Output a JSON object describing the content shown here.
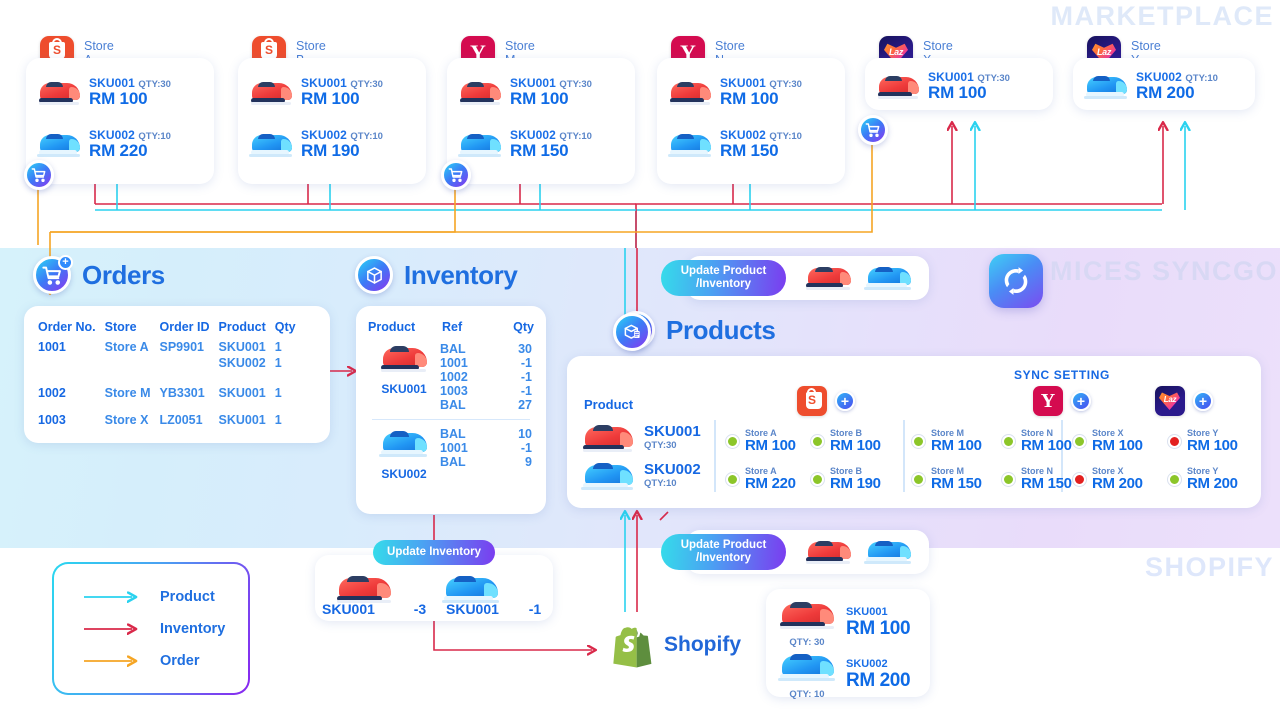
{
  "watermarks": {
    "top_right": "MARKETPLACE",
    "middle_right": "MICES SYNCGO",
    "bottom_right": "SHOPIFY"
  },
  "marketplace": {
    "stores": [
      {
        "name": "Store A",
        "platform": "shopee",
        "platform_icon": "shopee-icon",
        "has_cart_badge": true,
        "items": [
          {
            "sku": "SKU001",
            "qty": "QTY:30",
            "price": "RM 100",
            "shoe": "red"
          },
          {
            "sku": "SKU002",
            "qty": "QTY:10",
            "price": "RM 220",
            "shoe": "blue"
          }
        ]
      },
      {
        "name": "Store B",
        "platform": "shopee",
        "platform_icon": "shopee-icon",
        "has_cart_badge": false,
        "items": [
          {
            "sku": "SKU001",
            "qty": "QTY:30",
            "price": "RM 100",
            "shoe": "red"
          },
          {
            "sku": "SKU002",
            "qty": "QTY:10",
            "price": "RM 190",
            "shoe": "blue"
          }
        ]
      },
      {
        "name": "Store M",
        "platform": "yahoo",
        "platform_icon": "yahoo-icon",
        "has_cart_badge": true,
        "items": [
          {
            "sku": "SKU001",
            "qty": "QTY:30",
            "price": "RM 100",
            "shoe": "red"
          },
          {
            "sku": "SKU002",
            "qty": "QTY:10",
            "price": "RM 150",
            "shoe": "blue"
          }
        ]
      },
      {
        "name": "Store N",
        "platform": "yahoo",
        "platform_icon": "yahoo-icon",
        "has_cart_badge": false,
        "items": [
          {
            "sku": "SKU001",
            "qty": "QTY:30",
            "price": "RM 100",
            "shoe": "red"
          },
          {
            "sku": "SKU002",
            "qty": "QTY:10",
            "price": "RM 150",
            "shoe": "blue"
          }
        ]
      },
      {
        "name": "Store X",
        "platform": "lazada",
        "platform_icon": "lazada-icon",
        "has_cart_badge": true,
        "items": [
          {
            "sku": "SKU001",
            "qty": "QTY:30",
            "price": "RM 100",
            "shoe": "red"
          }
        ]
      },
      {
        "name": "Store Y",
        "platform": "lazada",
        "platform_icon": "lazada-icon",
        "has_cart_badge": false,
        "items": [
          {
            "sku": "SKU002",
            "qty": "QTY:10",
            "price": "RM 200",
            "shoe": "blue"
          }
        ]
      }
    ]
  },
  "orders": {
    "title": "Orders",
    "icon": "cart-plus-icon",
    "columns": [
      "Order No.",
      "Store",
      "Order ID",
      "Product",
      "Qty"
    ],
    "rows": [
      {
        "order_no": "1001",
        "store": "Store A",
        "order_id": "SP9901",
        "product": "SKU001",
        "qty": "1"
      },
      {
        "order_no": "",
        "store": "",
        "order_id": "",
        "product": "SKU002",
        "qty": "1"
      },
      {
        "order_no": "1002",
        "store": "Store M",
        "order_id": "YB3301",
        "product": "SKU001",
        "qty": "1"
      },
      {
        "order_no": "1003",
        "store": "Store X",
        "order_id": "LZ0051",
        "product": "SKU001",
        "qty": "1"
      }
    ]
  },
  "inventory": {
    "title": "Inventory",
    "icon": "box-sync-icon",
    "columns": [
      "Product",
      "Ref",
      "Qty"
    ],
    "groups": [
      {
        "sku": "SKU001",
        "shoe": "red",
        "lines": [
          {
            "ref": "BAL",
            "qty": "30"
          },
          {
            "ref": "1001",
            "qty": "-1"
          },
          {
            "ref": "1002",
            "qty": "-1"
          },
          {
            "ref": "1003",
            "qty": "-1"
          },
          {
            "ref": "BAL",
            "qty": "27"
          }
        ]
      },
      {
        "sku": "SKU002",
        "shoe": "blue",
        "lines": [
          {
            "ref": "BAL",
            "qty": "10"
          },
          {
            "ref": "1001",
            "qty": "-1"
          },
          {
            "ref": "BAL",
            "qty": "9"
          }
        ]
      }
    ]
  },
  "products": {
    "title": "Products",
    "icon": "product-box-icon",
    "sync_setting_label": "SYNC SETTING",
    "product_column_label": "Product",
    "platform_groups": [
      {
        "platform": "shopee",
        "platform_icon": "shopee-icon",
        "add_label": "+"
      },
      {
        "platform": "yahoo",
        "platform_icon": "yahoo-icon",
        "add_label": "+"
      },
      {
        "platform": "lazada",
        "platform_icon": "lazada-icon",
        "add_label": "+"
      }
    ],
    "rows": [
      {
        "sku": "SKU001",
        "qty": "QTY:30",
        "shoe": "red",
        "cells": [
          {
            "store": "Store A",
            "price": "RM 100",
            "status": "green"
          },
          {
            "store": "Store B",
            "price": "RM 100",
            "status": "green"
          },
          {
            "store": "Store M",
            "price": "RM 100",
            "status": "green"
          },
          {
            "store": "Store N",
            "price": "RM 100",
            "status": "green"
          },
          {
            "store": "Store X",
            "price": "RM 100",
            "status": "green"
          },
          {
            "store": "Store Y",
            "price": "RM 100",
            "status": "red"
          }
        ]
      },
      {
        "sku": "SKU002",
        "qty": "QTY:10",
        "shoe": "blue",
        "cells": [
          {
            "store": "Store A",
            "price": "RM 220",
            "status": "green"
          },
          {
            "store": "Store B",
            "price": "RM 190",
            "status": "green"
          },
          {
            "store": "Store M",
            "price": "RM 150",
            "status": "green"
          },
          {
            "store": "Store N",
            "price": "RM 150",
            "status": "green"
          },
          {
            "store": "Store X",
            "price": "RM 200",
            "status": "red"
          },
          {
            "store": "Store Y",
            "price": "RM 200",
            "status": "green"
          }
        ]
      }
    ]
  },
  "update_badges": {
    "top": {
      "label": "Update Product\n/Inventory",
      "line1": "Update Product",
      "line2": "/Inventory"
    },
    "bottom": {
      "label": "Update Product\n/Inventory",
      "line1": "Update Product",
      "line2": "/Inventory"
    }
  },
  "update_inventory": {
    "pill_label": "Update Inventory",
    "items": [
      {
        "sku": "SKU001",
        "delta": "-3",
        "shoe": "red"
      },
      {
        "sku": "SKU001",
        "delta": "-1",
        "shoe": "blue"
      }
    ]
  },
  "shopify": {
    "name": "Shopify",
    "icon": "shopify-bag-icon",
    "items": [
      {
        "sku": "SKU001",
        "qty": "QTY: 30",
        "price": "RM 100",
        "shoe": "red"
      },
      {
        "sku": "SKU002",
        "qty": "QTY: 10",
        "price": "RM 200",
        "shoe": "blue"
      }
    ]
  },
  "syncgo": {
    "logo_label": "S",
    "logo_icon": "syncgo-logo-icon"
  },
  "legend": {
    "items": [
      {
        "label": "Product",
        "color": "#2ad2ef"
      },
      {
        "label": "Inventory",
        "color": "#d9294a"
      },
      {
        "label": "Order",
        "color": "#f5a524"
      }
    ]
  },
  "colors": {
    "product_flow": "#2ad2ef",
    "inventory_flow": "#d9294a",
    "order_flow": "#f5a524",
    "primary_blue": "#1f6fe0",
    "price_blue": "#0f6be6",
    "status_green": "#8cc62a",
    "status_red": "#e32020",
    "shopee_orange": "#ee4d2d",
    "yahoo_red": "#d40b4f",
    "lazada_navy": "#1a1464",
    "shopify_green": "#95bf47"
  }
}
